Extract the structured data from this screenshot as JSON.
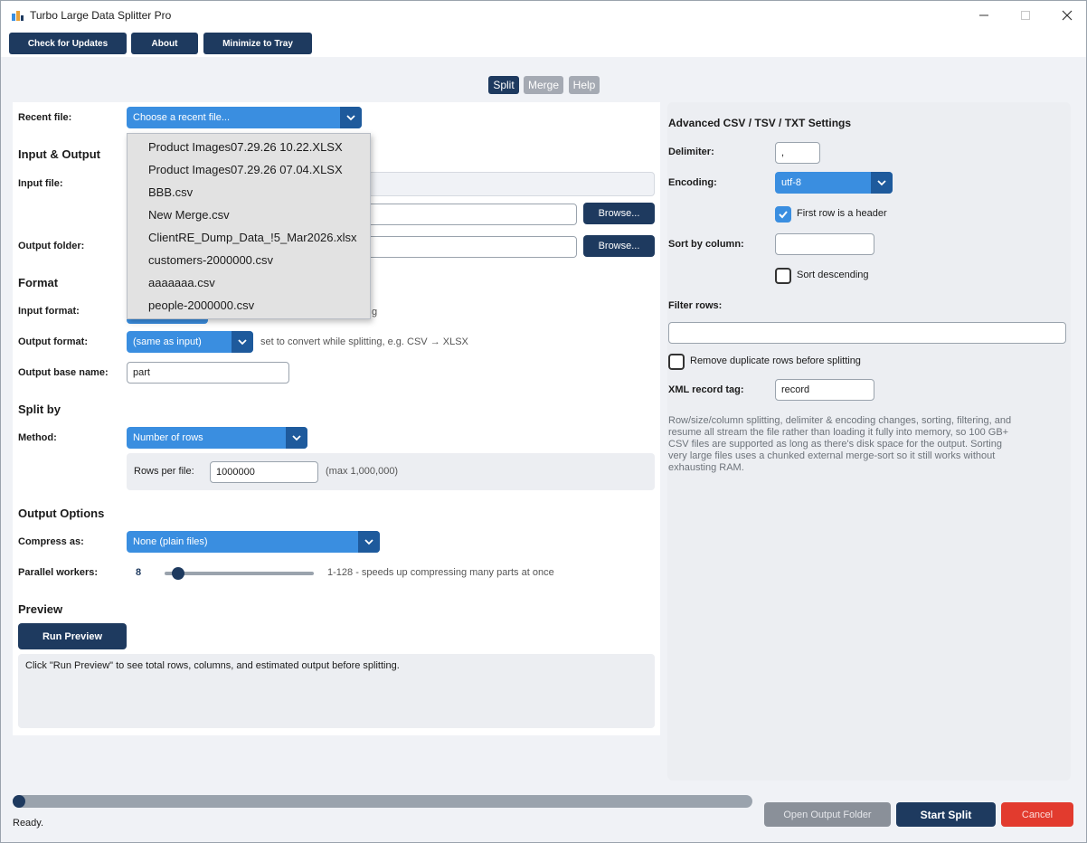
{
  "app": {
    "title": "Turbo Large Data Splitter Pro"
  },
  "toolbar": {
    "check_updates": "Check for Updates",
    "about": "About",
    "minimize_tray": "Minimize to Tray"
  },
  "tabs": [
    {
      "label": "Split"
    },
    {
      "label": "Merge"
    },
    {
      "label": "Help"
    }
  ],
  "recent": {
    "label": "Recent file:",
    "placeholder": "Choose a recent file...",
    "items": [
      "Product Images07.29.26 10.22.XLSX",
      "Product Images07.29.26 07.04.XLSX",
      "BBB.csv",
      "New Merge.csv",
      "ClientRE_Dump_Data_!5_Mar2026.xlsx",
      "customers-2000000.csv",
      "aaaaaaa.csv",
      "people-2000000.csv"
    ]
  },
  "io": {
    "section": "Input & Output",
    "input_file_label": "Input file:",
    "output_folder_label": "Output folder:",
    "browse": "Browse..."
  },
  "format": {
    "section": "Format",
    "input_format_label": "Input format:",
    "input_format_hint": "g",
    "output_format_label": "Output format:",
    "output_format_value": "(same as input)",
    "output_format_hint": "set to convert while splitting, e.g. CSV → XLSX",
    "base_name_label": "Output base name:",
    "base_name_value": "part"
  },
  "splitby": {
    "section": "Split by",
    "method_label": "Method:",
    "method_value": "Number of rows",
    "rows_label": "Rows per file:",
    "rows_value": "1000000",
    "rows_hint": "(max 1,000,000)"
  },
  "options": {
    "section": "Output Options",
    "compress_label": "Compress as:",
    "compress_value": "None (plain files)",
    "workers_label": "Parallel workers:",
    "workers_value": "8",
    "workers_hint": "1-128 - speeds up compressing many parts at once",
    "workers_min": 1,
    "workers_max": 128
  },
  "preview": {
    "section": "Preview",
    "run": "Run Preview",
    "text": "Click \"Run Preview\" to see total rows, columns, and estimated output before splitting."
  },
  "advanced": {
    "title": "Advanced CSV / TSV / TXT Settings",
    "delimiter_label": "Delimiter:",
    "delimiter_value": ",",
    "encoding_label": "Encoding:",
    "encoding_value": "utf-8",
    "header_label": "First row is a header",
    "header_checked": true,
    "sort_label": "Sort by column:",
    "sort_value": "",
    "sort_desc_label": "Sort descending",
    "sort_desc_checked": false,
    "filter_label": "Filter rows:",
    "filter_value": "",
    "dedupe_label": "Remove duplicate rows before splitting",
    "dedupe_checked": false,
    "xml_label": "XML record tag:",
    "xml_value": "record",
    "description": "Row/size/column splitting, delimiter & encoding changes, sorting, filtering, and resume all stream the file rather than loading it fully into memory, so 100 GB+ CSV files are supported as long as there's disk space for the output. Sorting very large files uses a chunked external merge-sort so it still works without exhausting RAM."
  },
  "footer": {
    "status": "Ready.",
    "progress": 0,
    "open_folder": "Open Output Folder",
    "start": "Start Split",
    "cancel": "Cancel"
  },
  "colors": {
    "navy": "#1e3a5f",
    "accent": "#3a8ee0",
    "danger": "#e23b2e",
    "disabled": "#8a9099"
  }
}
